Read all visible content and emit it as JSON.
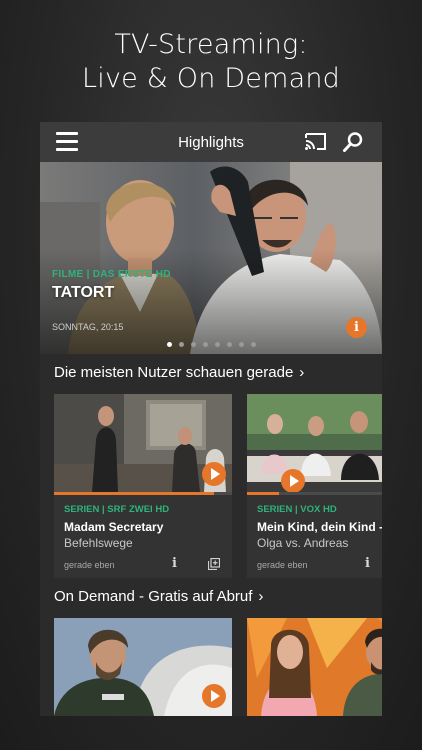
{
  "promo": {
    "line1": "TV-Streaming:",
    "line2": "Live & On Demand"
  },
  "appbar": {
    "title": "Highlights",
    "icons": [
      "menu-icon",
      "cast-icon",
      "search-icon"
    ]
  },
  "hero": {
    "category": "FILME | DAS ERSTE HD",
    "title": "TATORT",
    "time": "SONNTAG, 20:15",
    "slide_count": 8,
    "active_slide": 1,
    "info_label": "i"
  },
  "section_popular": {
    "title": "Die meisten Nutzer schauen gerade",
    "chevron": "›",
    "cards": [
      {
        "category": "SERIEN | SRF ZWEI HD",
        "title": "Madam Secretary",
        "subtitle": "Befehlswege",
        "time": "gerade eben",
        "info_label": "i",
        "progress": 0.9
      },
      {
        "category": "SERIEN | VOX HD",
        "title": "Mein Kind, dein Kind - W",
        "subtitle": "Olga vs. Andreas",
        "time": "gerade eben",
        "info_label": "i",
        "progress": 0.18
      }
    ]
  },
  "section_ondemand": {
    "title": "On Demand - Gratis auf Abruf",
    "chevron": "›"
  },
  "colors": {
    "accent": "#e5762a",
    "category_green": "#2fb37a",
    "appbar": "#3c3c3c",
    "panel": "#2b2b2b"
  }
}
